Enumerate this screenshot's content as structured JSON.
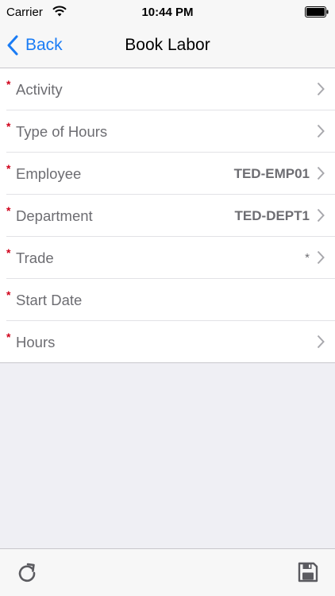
{
  "status_bar": {
    "carrier": "Carrier",
    "time": "10:44 PM"
  },
  "nav": {
    "back_label": "Back",
    "title": "Book Labor"
  },
  "form": {
    "rows": [
      {
        "label": "Activity",
        "value": "",
        "required": true,
        "chevron": true
      },
      {
        "label": "Type of Hours",
        "value": "",
        "required": true,
        "chevron": true
      },
      {
        "label": "Employee",
        "value": "TED-EMP01",
        "required": true,
        "chevron": true
      },
      {
        "label": "Department",
        "value": "TED-DEPT1",
        "required": true,
        "chevron": true
      },
      {
        "label": "Trade",
        "value": "*",
        "required": true,
        "chevron": true
      },
      {
        "label": "Start Date",
        "value": "",
        "required": true,
        "chevron": false
      },
      {
        "label": "Hours",
        "value": "",
        "required": true,
        "chevron": true
      }
    ]
  },
  "required_marker": "*",
  "toolbar": {
    "left_icon": "refresh-icon",
    "right_icon": "save-icon"
  },
  "colors": {
    "accent": "#1a7cf5",
    "required": "#d0021b",
    "label": "#6d6d72"
  }
}
